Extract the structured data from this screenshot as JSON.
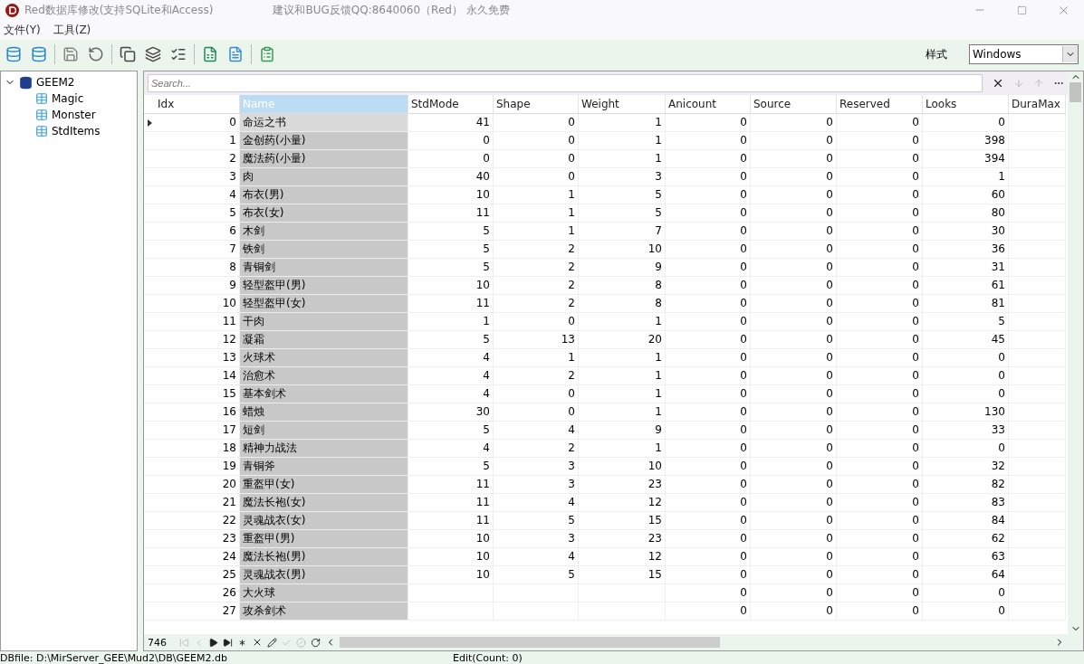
{
  "window": {
    "title": "Red数据库修改(支持SQLite和Access)",
    "subtitle": "建议和BUG反馈QQ:8640060（Red） 永久免费"
  },
  "menu": [
    {
      "label": "文件(Y)"
    },
    {
      "label": "工具(Z)"
    }
  ],
  "toolbar": {
    "style_label": "样式",
    "style_value": "Windows"
  },
  "tree": {
    "label": "GEEM2",
    "expanded": true,
    "children": [
      {
        "label": "Magic"
      },
      {
        "label": "Monster"
      },
      {
        "label": "StdItems"
      }
    ]
  },
  "search": {
    "placeholder": "Search..."
  },
  "table": {
    "columns": [
      {
        "label": "Idx",
        "selected": false
      },
      {
        "label": "Name",
        "selected": true
      },
      {
        "label": "StdMode",
        "selected": false
      },
      {
        "label": "Shape",
        "selected": false
      },
      {
        "label": "Weight",
        "selected": false
      },
      {
        "label": "Anicount",
        "selected": false
      },
      {
        "label": "Source",
        "selected": false
      },
      {
        "label": "Reserved",
        "selected": false
      },
      {
        "label": "Looks",
        "selected": false
      },
      {
        "label": "DuraMax",
        "selected": false
      }
    ],
    "rows": [
      {
        "selected": true,
        "cells": [
          "0",
          "命运之书",
          "41",
          "0",
          "1",
          "0",
          "0",
          "0",
          "0"
        ]
      },
      {
        "selected": false,
        "cells": [
          "1",
          "金创药(小量)",
          "0",
          "0",
          "1",
          "0",
          "0",
          "0",
          "398"
        ]
      },
      {
        "selected": false,
        "cells": [
          "2",
          "魔法药(小量)",
          "0",
          "0",
          "1",
          "0",
          "0",
          "0",
          "394"
        ]
      },
      {
        "selected": false,
        "cells": [
          "3",
          "肉",
          "40",
          "0",
          "3",
          "0",
          "0",
          "0",
          "1"
        ]
      },
      {
        "selected": false,
        "cells": [
          "4",
          "布衣(男)",
          "10",
          "1",
          "5",
          "0",
          "0",
          "0",
          "60"
        ]
      },
      {
        "selected": false,
        "cells": [
          "5",
          "布衣(女)",
          "11",
          "1",
          "5",
          "0",
          "0",
          "0",
          "80"
        ]
      },
      {
        "selected": false,
        "cells": [
          "6",
          "木剑",
          "5",
          "1",
          "7",
          "0",
          "0",
          "0",
          "30"
        ]
      },
      {
        "selected": false,
        "cells": [
          "7",
          "铁剑",
          "5",
          "2",
          "10",
          "0",
          "0",
          "0",
          "36"
        ]
      },
      {
        "selected": false,
        "cells": [
          "8",
          "青铜剑",
          "5",
          "2",
          "9",
          "0",
          "0",
          "0",
          "31"
        ]
      },
      {
        "selected": false,
        "cells": [
          "9",
          "轻型盔甲(男)",
          "10",
          "2",
          "8",
          "0",
          "0",
          "0",
          "61"
        ]
      },
      {
        "selected": false,
        "cells": [
          "10",
          "轻型盔甲(女)",
          "11",
          "2",
          "8",
          "0",
          "0",
          "0",
          "81"
        ]
      },
      {
        "selected": false,
        "cells": [
          "11",
          "干肉",
          "1",
          "0",
          "1",
          "0",
          "0",
          "0",
          "5"
        ]
      },
      {
        "selected": false,
        "cells": [
          "12",
          "凝霜",
          "5",
          "13",
          "20",
          "0",
          "0",
          "0",
          "45"
        ]
      },
      {
        "selected": false,
        "cells": [
          "13",
          "火球术",
          "4",
          "1",
          "1",
          "0",
          "0",
          "0",
          "0"
        ]
      },
      {
        "selected": false,
        "cells": [
          "14",
          "治愈术",
          "4",
          "2",
          "1",
          "0",
          "0",
          "0",
          "0"
        ]
      },
      {
        "selected": false,
        "cells": [
          "15",
          "基本剑术",
          "4",
          "0",
          "1",
          "0",
          "0",
          "0",
          "0"
        ]
      },
      {
        "selected": false,
        "cells": [
          "16",
          "蜡烛",
          "30",
          "0",
          "1",
          "0",
          "0",
          "0",
          "130"
        ]
      },
      {
        "selected": false,
        "cells": [
          "17",
          "短剑",
          "5",
          "4",
          "9",
          "0",
          "0",
          "0",
          "33"
        ]
      },
      {
        "selected": false,
        "cells": [
          "18",
          "精神力战法",
          "4",
          "2",
          "1",
          "0",
          "0",
          "0",
          "0"
        ]
      },
      {
        "selected": false,
        "cells": [
          "19",
          "青铜斧",
          "5",
          "3",
          "10",
          "0",
          "0",
          "0",
          "32"
        ]
      },
      {
        "selected": false,
        "cells": [
          "20",
          "重盔甲(女)",
          "11",
          "3",
          "23",
          "0",
          "0",
          "0",
          "82"
        ]
      },
      {
        "selected": false,
        "cells": [
          "21",
          "魔法长袍(女)",
          "11",
          "4",
          "12",
          "0",
          "0",
          "0",
          "83"
        ]
      },
      {
        "selected": false,
        "cells": [
          "22",
          "灵魂战衣(女)",
          "11",
          "5",
          "15",
          "0",
          "0",
          "0",
          "84"
        ]
      },
      {
        "selected": false,
        "cells": [
          "23",
          "重盔甲(男)",
          "10",
          "3",
          "23",
          "0",
          "0",
          "0",
          "62"
        ]
      },
      {
        "selected": false,
        "cells": [
          "24",
          "魔法长袍(男)",
          "10",
          "4",
          "12",
          "0",
          "0",
          "0",
          "63"
        ]
      },
      {
        "selected": false,
        "cells": [
          "25",
          "灵魂战衣(男)",
          "10",
          "5",
          "15",
          "0",
          "0",
          "0",
          "64"
        ]
      },
      {
        "selected": false,
        "cells": [
          "26",
          "大火球",
          null,
          null,
          null,
          "0",
          "0",
          "0",
          "0"
        ]
      },
      {
        "selected": false,
        "cells": [
          "27",
          "攻杀剑术",
          null,
          null,
          null,
          "0",
          "0",
          "0",
          "0"
        ]
      }
    ]
  },
  "navigator": {
    "count": "746"
  },
  "status_bar": {
    "file": "DBfile: D:\\MirServer_GEE\\Mud2\\DB\\GEEM2.db",
    "edit": "Edit(Count: 0)"
  }
}
